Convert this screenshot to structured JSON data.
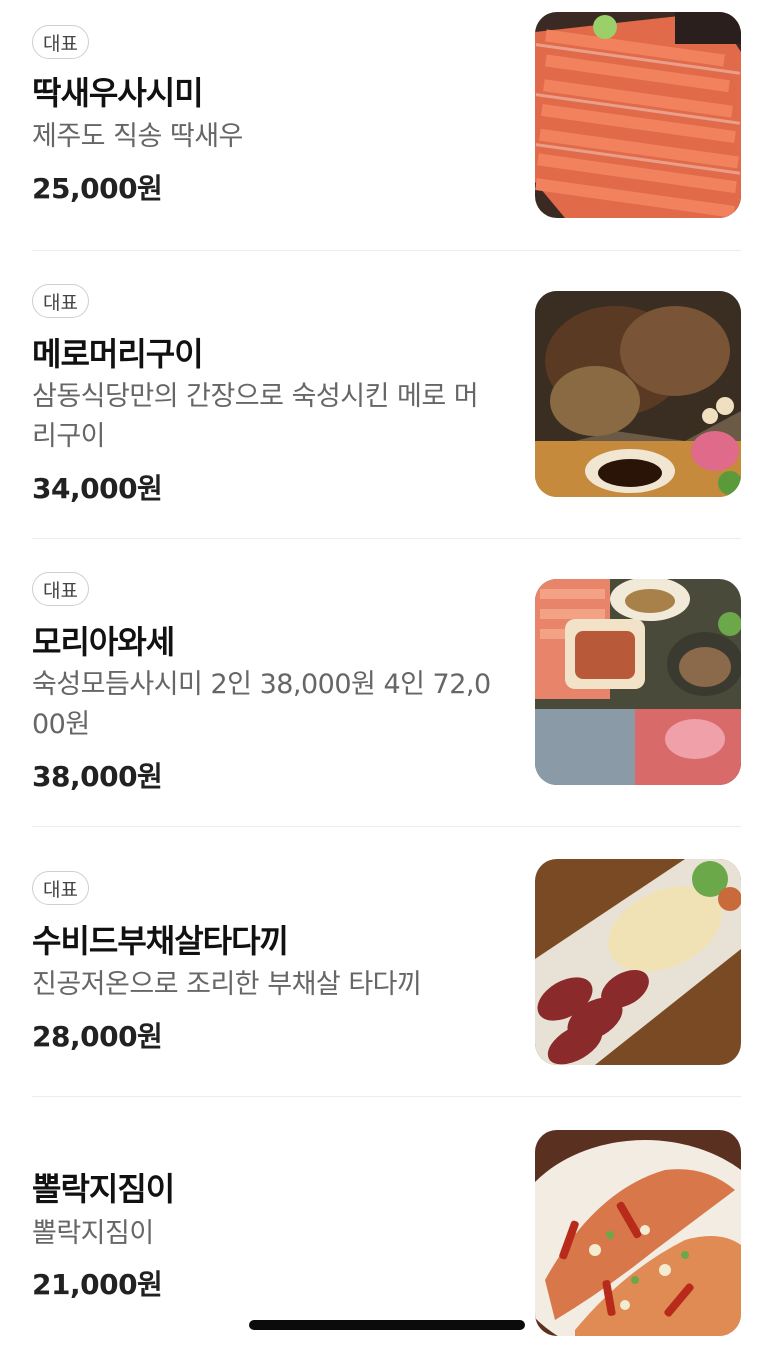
{
  "menu": {
    "items": [
      {
        "badge": "대표",
        "name": "딱새우사시미",
        "description": "제주도 직송 딱새우",
        "price": "25,000원",
        "photo_icon": "shrimp-sashimi-photo"
      },
      {
        "badge": "대표",
        "name": "메로머리구이",
        "description": "삼동식당만의 간장으로 숙성시킨 메로 머리구이",
        "price": "34,000원",
        "photo_icon": "grilled-fish-head-photo"
      },
      {
        "badge": "대표",
        "name": "모리아와세",
        "description": "숙성모듬사시미 2인 38,000원 4인 72,000원",
        "price": "38,000원",
        "photo_icon": "assorted-sashimi-photo"
      },
      {
        "badge": "대표",
        "name": "수비드부채살타다끼",
        "description": "진공저온으로 조리한 부채살 타다끼",
        "price": "28,000원",
        "photo_icon": "beef-tataki-photo"
      },
      {
        "name": "뽈락지짐이",
        "description": "뽈락지짐이",
        "price": "21,000원",
        "photo_icon": "braised-rockfish-photo"
      }
    ]
  },
  "colors": {
    "text": "#111111",
    "description": "#666666",
    "badge_border": "#cfcfcf",
    "divider": "#ececec"
  }
}
